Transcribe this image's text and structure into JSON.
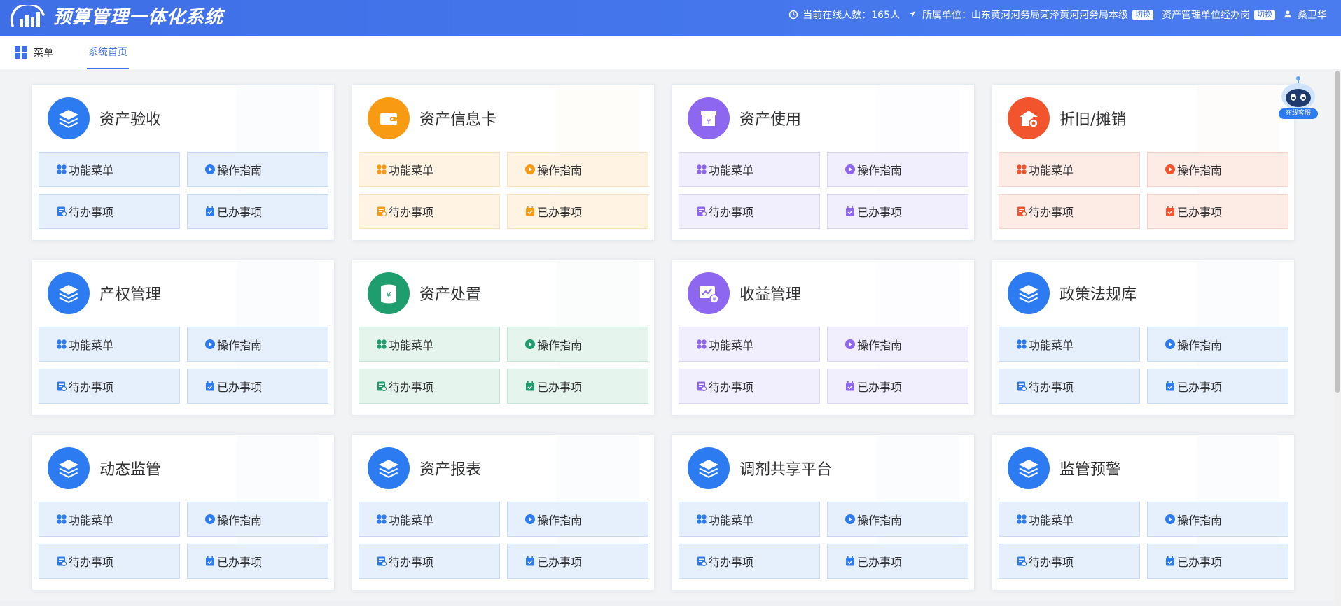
{
  "header": {
    "app_title": "预算管理一体化系统",
    "online_label": "当前在线人数：165人",
    "unit_label": "所属单位：山东黄河河务局菏泽黄河河务局本级",
    "unit_switch": "切换",
    "role_label": "资产管理单位经办岗",
    "role_switch": "切换",
    "user_name": "桑卫华"
  },
  "tabbar": {
    "menu_label": "菜单",
    "active_tab": "系统首页"
  },
  "robot": {
    "label": "在线客服"
  },
  "button_labels": {
    "function_menu": "功能菜单",
    "guide": "操作指南",
    "todo": "待办事项",
    "done": "已办事项"
  },
  "cards": [
    {
      "title": "资产验收",
      "theme": "blue",
      "icon": "layers-icon",
      "color": "#2d7bf0"
    },
    {
      "title": "资产信息卡",
      "theme": "orange",
      "icon": "wallet-icon",
      "color": "#f99a13"
    },
    {
      "title": "资产使用",
      "theme": "purple",
      "icon": "yuan-box-icon",
      "color": "#8e67f0"
    },
    {
      "title": "折旧/摊销",
      "theme": "red",
      "icon": "house-coin-icon",
      "color": "#f2542d"
    },
    {
      "title": "产权管理",
      "theme": "blue",
      "icon": "layers-icon",
      "color": "#2d7bf0"
    },
    {
      "title": "资产处置",
      "theme": "green",
      "icon": "coin-stack-icon",
      "color": "#1e9e6e"
    },
    {
      "title": "收益管理",
      "theme": "purple",
      "icon": "chart-yuan-icon",
      "color": "#8e67f0"
    },
    {
      "title": "政策法规库",
      "theme": "blue",
      "icon": "layers-icon",
      "color": "#2d7bf0"
    },
    {
      "title": "动态监管",
      "theme": "blue",
      "icon": "layers-icon",
      "color": "#2d7bf0"
    },
    {
      "title": "资产报表",
      "theme": "blue",
      "icon": "layers-icon",
      "color": "#2d7bf0"
    },
    {
      "title": "调剂共享平台",
      "theme": "blue",
      "icon": "layers-icon",
      "color": "#2d7bf0"
    },
    {
      "title": "监管预警",
      "theme": "blue",
      "icon": "layers-icon",
      "color": "#2d7bf0"
    }
  ]
}
